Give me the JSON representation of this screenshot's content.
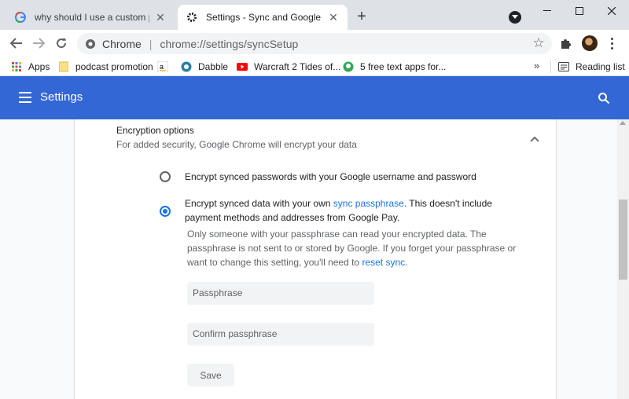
{
  "tabs": [
    {
      "title": "why should I use a custom passphrase",
      "active": false
    },
    {
      "title": "Settings - Sync and Google services",
      "active": true
    }
  ],
  "toolbar": {
    "origin": "Chrome",
    "url": "chrome://settings/syncSetup"
  },
  "bookmarks": {
    "items": [
      {
        "label": "Apps",
        "icon": "apps-grid-icon"
      },
      {
        "label": "podcast promotion",
        "icon": "folder-icon"
      },
      {
        "label": "",
        "icon": "amazon-icon"
      },
      {
        "label": "Dabble",
        "icon": "dabble-icon"
      },
      {
        "label": "Warcraft 2 Tides of...",
        "icon": "youtube-icon"
      },
      {
        "label": "5 free text apps for...",
        "icon": "android-icon"
      }
    ],
    "overflow": "»",
    "reading_list": "Reading list"
  },
  "settings": {
    "title": "Settings"
  },
  "encryption": {
    "title": "Encryption options",
    "subtitle": "For added security, Google Chrome will encrypt your data",
    "option1": "Encrypt synced passwords with your Google username and password",
    "option2_before": "Encrypt synced data with your own ",
    "option2_link": "sync passphrase",
    "option2_after": ". This doesn't include payment methods and addresses from Google Pay.",
    "note_before": "Only someone with your passphrase can read your encrypted data. The passphrase is not sent to or stored by Google. If you forget your passphrase or want to change this setting, you'll need to ",
    "note_link": "reset sync",
    "note_after": ".",
    "passphrase_placeholder": "Passphrase",
    "confirm_placeholder": "Confirm passphrase",
    "save_label": "Save",
    "selected_option": 2
  },
  "colors": {
    "header": "#3367d6",
    "accent": "#1a73e8"
  }
}
